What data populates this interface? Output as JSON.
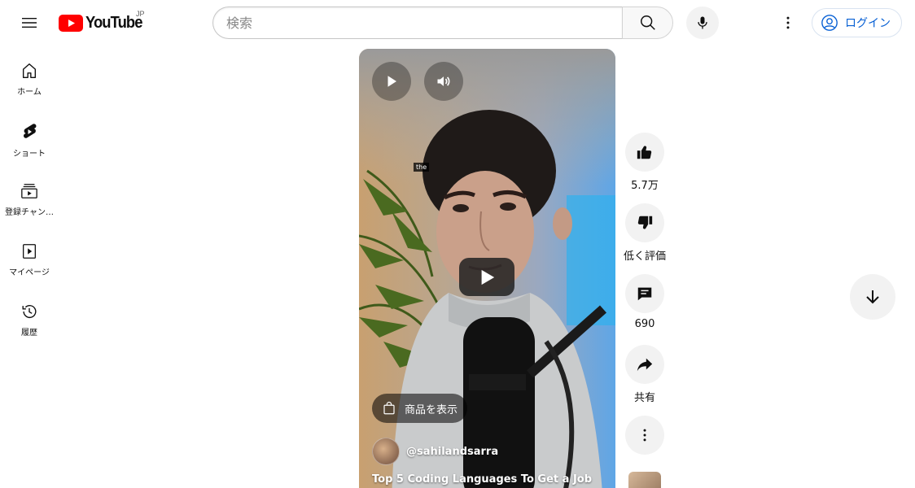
{
  "header": {
    "logo_text": "YouTube",
    "logo_region": "JP",
    "search_placeholder": "検索",
    "login_label": "ログイン"
  },
  "sidebar": {
    "items": [
      {
        "label": "ホーム",
        "icon": "home-icon"
      },
      {
        "label": "ショート",
        "icon": "shorts-icon"
      },
      {
        "label": "登録チャン…",
        "icon": "subscriptions-icon"
      },
      {
        "label": "マイページ",
        "icon": "library-icon"
      },
      {
        "label": "履歴",
        "icon": "history-icon"
      }
    ]
  },
  "video": {
    "caption": "the",
    "product_label": "商品を表示",
    "channel": "@sahilandsarra",
    "title": "Top 5 Coding Languages To Get a Job"
  },
  "actions": {
    "likes": "5.7万",
    "dislike_label": "低く評価",
    "comments": "690",
    "share_label": "共有"
  },
  "colors": {
    "brand_red": "#ff0000",
    "link_blue": "#065fd4",
    "button_gray": "#f2f2f2"
  }
}
